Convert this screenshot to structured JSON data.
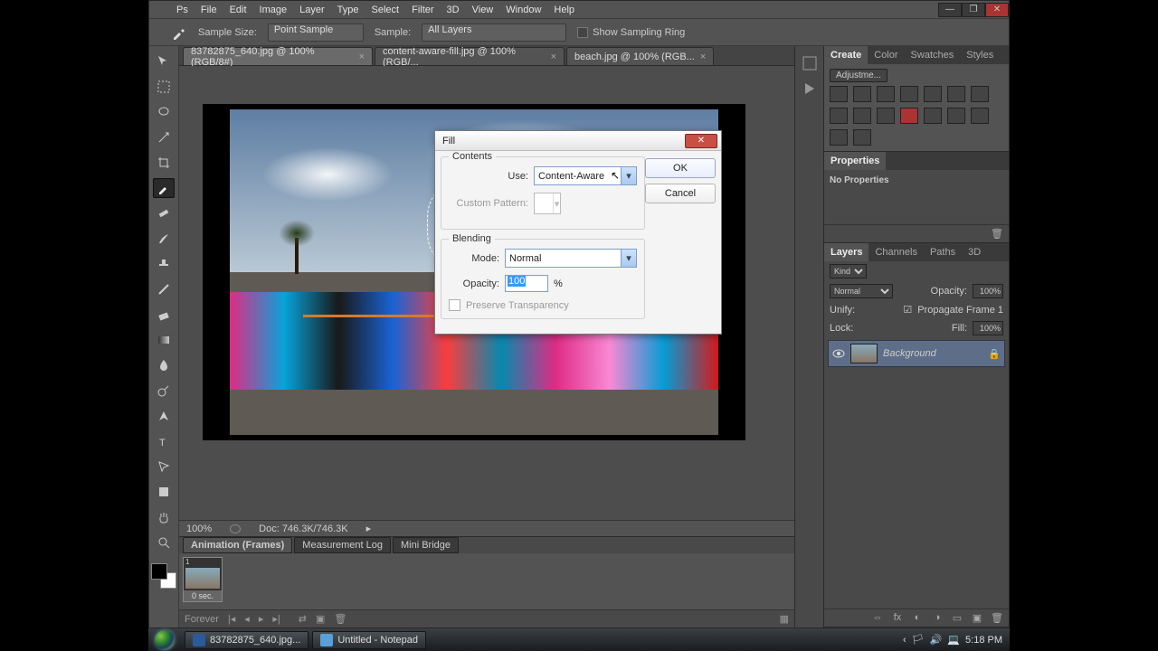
{
  "menubar": [
    "File",
    "Edit",
    "Image",
    "Layer",
    "Type",
    "Select",
    "Filter",
    "3D",
    "View",
    "Window",
    "Help"
  ],
  "options": {
    "sample_size_label": "Sample Size:",
    "sample_size_value": "Point Sample",
    "sample_label": "Sample:",
    "sample_value": "All Layers",
    "show_ring": "Show Sampling Ring"
  },
  "doc_tabs": [
    {
      "label": "83782875_640.jpg @ 100% (RGB/8#)",
      "active": true
    },
    {
      "label": "content-aware-fill.jpg @ 100% (RGB/...",
      "active": false
    },
    {
      "label": "beach.jpg @ 100% (RGB...",
      "active": false
    }
  ],
  "status": {
    "zoom": "100%",
    "doc": "Doc: 746.3K/746.3K"
  },
  "lower_tabs": [
    "Animation (Frames)",
    "Measurement Log",
    "Mini Bridge"
  ],
  "frame": {
    "num": "1",
    "delay": "0 sec."
  },
  "timeline_controls": {
    "forever": "Forever"
  },
  "right_panels": {
    "create_tabs": [
      "Create",
      "Color",
      "Swatches",
      "Styles"
    ],
    "adjust_label": "Adjustme...",
    "properties_tab": "Properties",
    "properties_body": "No Properties",
    "layer_tabs": [
      "Layers",
      "Channels",
      "Paths",
      "3D"
    ],
    "layers": {
      "kind": "Kind",
      "blend": "Normal",
      "opacity_label": "Opacity:",
      "opacity_value": "100%",
      "unify": "Unify:",
      "propagate": "Propagate Frame 1",
      "lock": "Lock:",
      "fill_label": "Fill:",
      "fill_value": "100%",
      "layer_name": "Background"
    }
  },
  "dialog": {
    "title": "Fill",
    "contents_legend": "Contents",
    "use_label": "Use:",
    "use_value": "Content-Aware",
    "pattern_label": "Custom Pattern:",
    "blending_legend": "Blending",
    "mode_label": "Mode:",
    "mode_value": "Normal",
    "opacity_label": "Opacity:",
    "opacity_value": "100",
    "opacity_pct": "%",
    "preserve": "Preserve Transparency",
    "ok": "OK",
    "cancel": "Cancel"
  },
  "taskbar": {
    "items": [
      {
        "label": "83782875_640.jpg..."
      },
      {
        "label": "Untitled - Notepad"
      }
    ],
    "time": "5:18 PM"
  }
}
